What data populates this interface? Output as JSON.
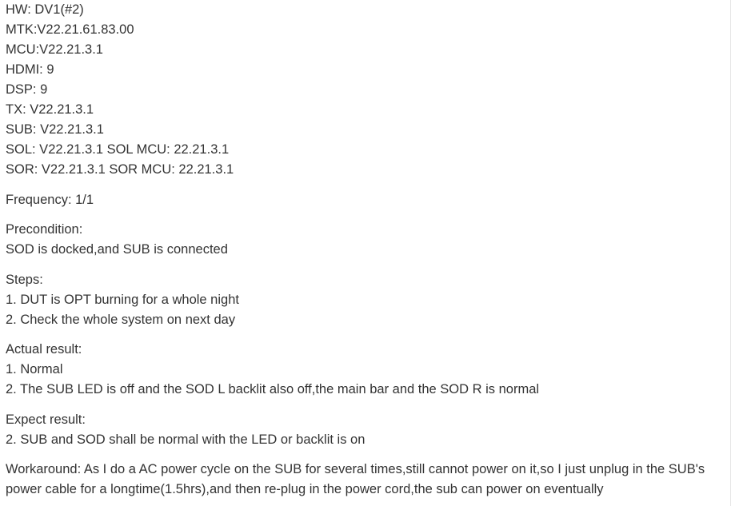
{
  "versions": {
    "hw": "HW: DV1(#2)",
    "mtk": "MTK:V22.21.61.83.00",
    "mcu": "MCU:V22.21.3.1",
    "hdmi": "HDMI: 9",
    "dsp": "DSP:  9",
    "tx": "TX:  V22.21.3.1",
    "sub": "SUB: V22.21.3.1",
    "sol": "SOL: V22.21.3.1 SOL MCU: 22.21.3.1",
    "sor": "SOR: V22.21.3.1 SOR MCU: 22.21.3.1"
  },
  "frequency": "Frequency: 1/1",
  "precondition": {
    "heading": "Precondition:",
    "text": "SOD is docked,and SUB is connected"
  },
  "steps": {
    "heading": "Steps:",
    "items": [
      "1. DUT is OPT burning for a whole night",
      "2. Check the whole system on next day"
    ]
  },
  "actual": {
    "heading": "Actual result:",
    "items": [
      "1. Normal",
      "2. The SUB LED is off and the SOD L backlit also off,the main bar and the SOD R is normal"
    ]
  },
  "expect": {
    "heading": "Expect result:",
    "items": [
      "2. SUB and SOD shall be normal with the LED or backlit is on"
    ]
  },
  "workaround": "Workaround: As I do a AC power cycle on the SUB for several times,still cannot power on it,so I just unplug in the SUB's power cable for a longtime(1.5hrs),and then re-plug in the power cord,the sub can power on eventually"
}
